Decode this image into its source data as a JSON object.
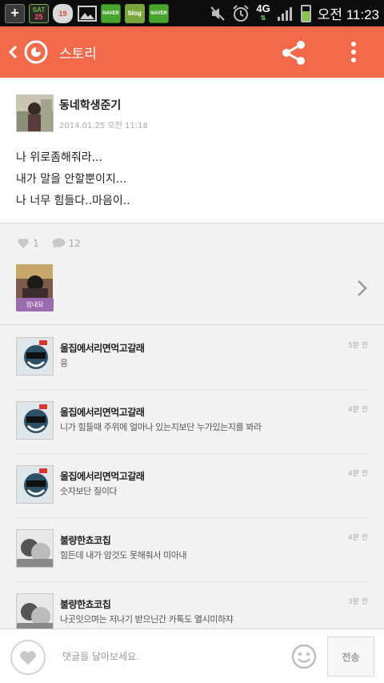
{
  "statusbar": {
    "sat_label": "SAT",
    "sat_day": "25",
    "cal_day": "19",
    "naver_label": "NAVER",
    "blog_label": "blog",
    "network": "4G",
    "time": "오전 11:23"
  },
  "appbar": {
    "title": "스토리",
    "accent_color": "#f26a4a"
  },
  "post": {
    "author": "동네학생준기",
    "date": "2014.01.25 오전 11:18",
    "lines": [
      "나 위로좀해줘라...",
      "내가 말을 안할뿐이지...",
      "나 너무 힘들다..마음이.."
    ]
  },
  "reactions": {
    "like_count": "1",
    "comment_count": "12"
  },
  "likers": {
    "badge": "힘내요"
  },
  "comments": [
    {
      "name": "울집에서리면먹고갈래",
      "text": "응",
      "time": "5분 전"
    },
    {
      "name": "울집에서리면먹고갈래",
      "text": "니가 힘들때 주위에 얼마나 있는지보단 누가있는지를 봐라",
      "time": "4분 전"
    },
    {
      "name": "울집에서리면먹고갈래",
      "text": "숫자보단 질이다",
      "time": "4분 전"
    },
    {
      "name": "불량한쵸코칩",
      "text": "힘든데 내가 암것도 못해줘서 미아내",
      "time": "4분 전"
    },
    {
      "name": "불량한쵸코칩",
      "text": "나곳잇으며는 저나기 받으닌간 카톡도 열시미하쟈",
      "time": "3분 전"
    }
  ],
  "footer": {
    "placeholder": "댓글을 달아보세요.",
    "send_label": "전송"
  }
}
